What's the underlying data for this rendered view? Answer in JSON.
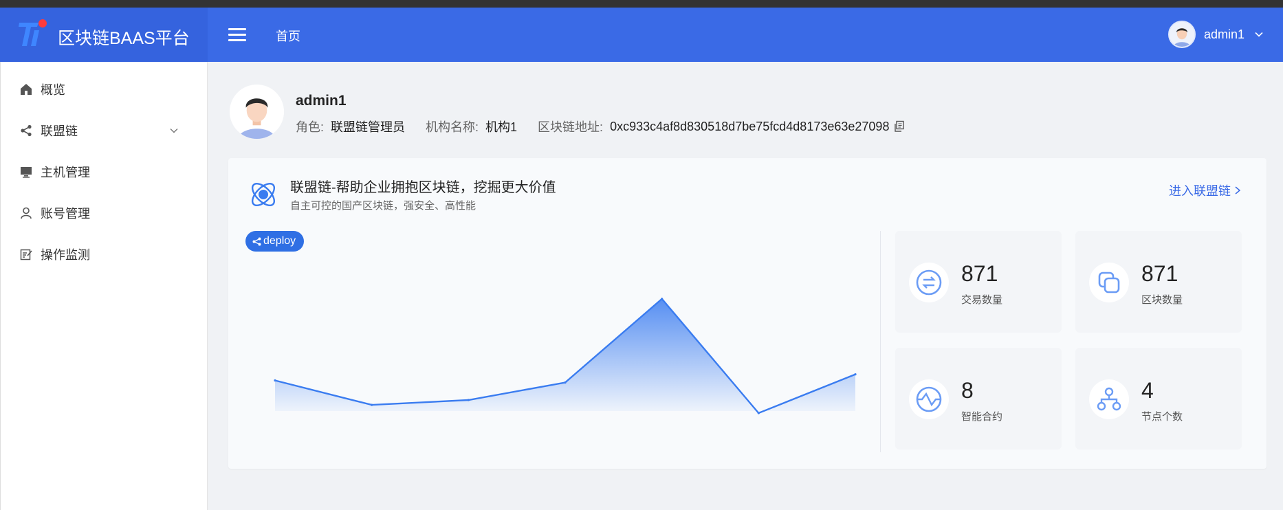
{
  "header": {
    "brand_text": "区块链BAAS平台",
    "breadcrumb": "首页",
    "username": "admin1",
    "accent": "#3a6ae6"
  },
  "sidebar": {
    "items": [
      {
        "label": "概览",
        "icon": "home-icon"
      },
      {
        "label": "联盟链",
        "icon": "share-icon",
        "expandable": true
      },
      {
        "label": "主机管理",
        "icon": "monitor-icon"
      },
      {
        "label": "账号管理",
        "icon": "user-icon"
      },
      {
        "label": "操作监测",
        "icon": "edit-checklist-icon"
      }
    ]
  },
  "profile": {
    "name": "admin1",
    "role_label": "角色:",
    "role_value": "联盟链管理员",
    "org_label": "机构名称:",
    "org_value": "机构1",
    "addr_label": "区块链地址:",
    "addr_value": "0xc933c4af8d830518d7be75fcd4d8173e63e27098"
  },
  "card": {
    "title": "联盟链-帮助企业拥抱区块链，挖掘更大价值",
    "subtitle": "自主可控的国产区块链，强安全、高性能",
    "enter_link": "进入联盟链",
    "deploy_label": "deploy"
  },
  "stats": [
    {
      "value": "871",
      "label": "交易数量",
      "icon": "swap-icon"
    },
    {
      "value": "871",
      "label": "区块数量",
      "icon": "blocks-icon"
    },
    {
      "value": "8",
      "label": "智能合约",
      "icon": "contract-wave-icon"
    },
    {
      "value": "4",
      "label": "节点个数",
      "icon": "nodes-icon"
    }
  ],
  "chart_data": {
    "type": "area",
    "series": [
      {
        "values": [
          0.75,
          0.15,
          0.27,
          0.7,
          2.75,
          -0.05,
          0.9
        ]
      }
    ],
    "ylim": [
      0,
      3
    ],
    "grid": false,
    "color": "#3a7cf0"
  }
}
